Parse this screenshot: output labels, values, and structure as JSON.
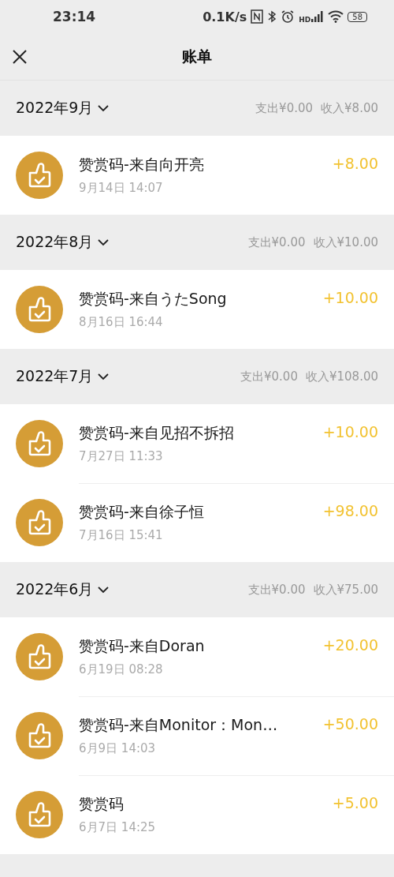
{
  "status_bar": {
    "time": "23:14",
    "speed": "0.1K/s",
    "network_label": "HD",
    "battery": "58"
  },
  "header": {
    "title": "账单"
  },
  "months": [
    {
      "label": "2022年9月",
      "expense": "支出¥0.00",
      "income": "收入¥8.00",
      "items": [
        {
          "title": "赞赏码-来自向开亮",
          "time": "9月14日 14:07",
          "amount": "+8.00"
        }
      ]
    },
    {
      "label": "2022年8月",
      "expense": "支出¥0.00",
      "income": "收入¥10.00",
      "items": [
        {
          "title": "赞赏码-来自うたSong",
          "time": "8月16日 16:44",
          "amount": "+10.00"
        }
      ]
    },
    {
      "label": "2022年7月",
      "expense": "支出¥0.00",
      "income": "收入¥108.00",
      "items": [
        {
          "title": "赞赏码-来自见招不拆招",
          "time": "7月27日 11:33",
          "amount": "+10.00"
        },
        {
          "title": "赞赏码-来自徐子恒",
          "time": "7月16日 15:41",
          "amount": "+98.00"
        }
      ]
    },
    {
      "label": "2022年6月",
      "expense": "支出¥0.00",
      "income": "收入¥75.00",
      "items": [
        {
          "title": "赞赏码-来自Doran",
          "time": "6月19日 08:28",
          "amount": "+20.00"
        },
        {
          "title": "赞赏码-来自Monitor：Mon…",
          "time": "6月9日 14:03",
          "amount": "+50.00"
        },
        {
          "title": "赞赏码",
          "time": "6月7日 14:25",
          "amount": "+5.00"
        }
      ]
    }
  ]
}
